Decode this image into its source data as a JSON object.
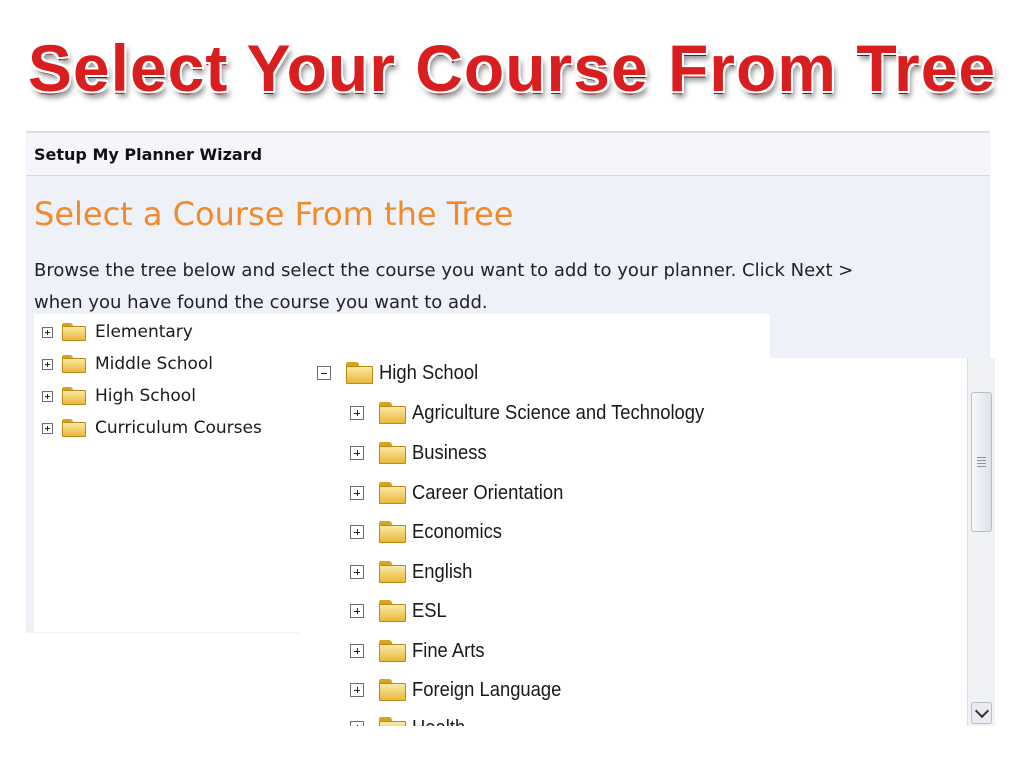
{
  "slide": {
    "title": "Select Your Course From Tree"
  },
  "wizard": {
    "header": "Setup My Planner Wizard",
    "heading": "Select a Course From the Tree",
    "instructions_line1": "Browse the tree below and select the course you want to add to your planner. Click Next >",
    "instructions_line2": "when you have found the course you want to add."
  },
  "tree_small": {
    "items": [
      {
        "label": "Elementary",
        "icon": "folder-icon",
        "state": "collapsed"
      },
      {
        "label": "Middle School",
        "icon": "folder-icon",
        "state": "collapsed"
      },
      {
        "label": "High School",
        "icon": "folder-icon",
        "state": "collapsed"
      },
      {
        "label": "Curriculum Courses",
        "icon": "folder-icon",
        "state": "collapsed"
      }
    ]
  },
  "tree_zoom": {
    "root": {
      "label": "High School",
      "icon": "folder-icon",
      "state": "expanded"
    },
    "children": [
      {
        "label": "Agriculture Science and Technology",
        "icon": "folder-icon",
        "state": "collapsed"
      },
      {
        "label": "Business",
        "icon": "folder-icon",
        "state": "collapsed"
      },
      {
        "label": "Career Orientation",
        "icon": "folder-icon",
        "state": "collapsed"
      },
      {
        "label": "Economics",
        "icon": "folder-icon",
        "state": "collapsed"
      },
      {
        "label": "English",
        "icon": "folder-icon",
        "state": "collapsed"
      },
      {
        "label": "ESL",
        "icon": "folder-icon",
        "state": "collapsed"
      },
      {
        "label": "Fine Arts",
        "icon": "folder-icon",
        "state": "collapsed"
      },
      {
        "label": "Foreign Language",
        "icon": "folder-icon",
        "state": "collapsed"
      },
      {
        "label": "Health",
        "icon": "folder-icon",
        "state": "collapsed"
      }
    ]
  },
  "colors": {
    "title_red": "#d81e1e",
    "heading_orange": "#f08a2a",
    "wizard_bg": "#eef1f8"
  }
}
